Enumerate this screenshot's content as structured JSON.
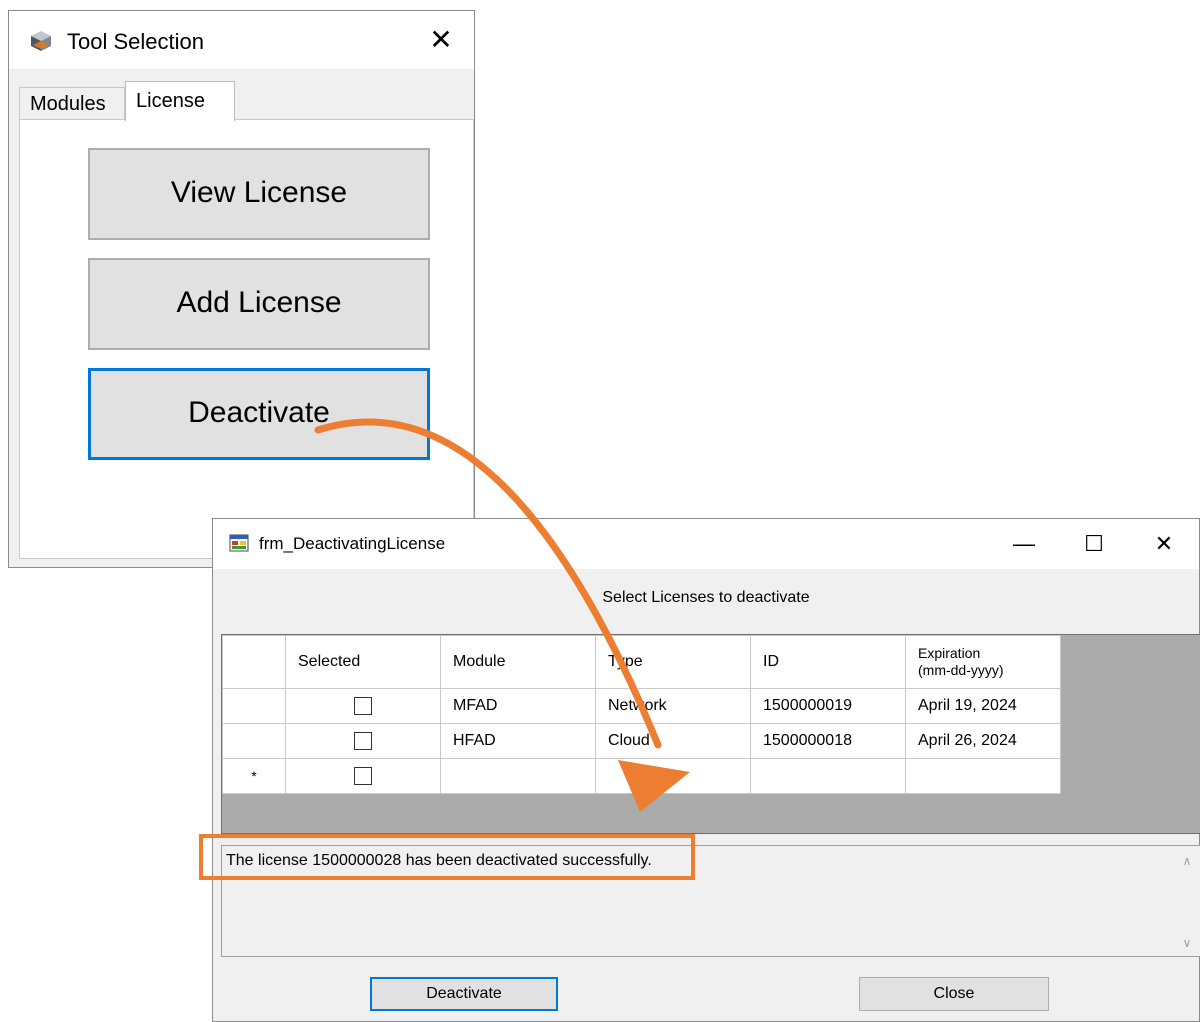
{
  "tool_window": {
    "title": "Tool Selection",
    "close_glyph": "✕",
    "icon": "cube-icon",
    "tabs": [
      {
        "label": "Modules",
        "selected": false
      },
      {
        "label": "License",
        "selected": true
      }
    ],
    "buttons": {
      "view": "View License",
      "add": "Add License",
      "deactivate": "Deactivate"
    }
  },
  "deactivate_window": {
    "title": "frm_DeactivatingLicense",
    "icon": "form-icon",
    "controls": {
      "minimize": "—",
      "maximize": "☐",
      "close": "✕"
    },
    "instruction": "Select Licenses to deactivate",
    "grid": {
      "columns": [
        "Selected",
        "Module",
        "Type",
        "ID",
        "Expiration",
        "(mm-dd-yyyy)"
      ],
      "rows": [
        {
          "selected": false,
          "module": "MFAD",
          "type": "Network",
          "id": "1500000019",
          "expiration": "April 19, 2024"
        },
        {
          "selected": false,
          "module": "HFAD",
          "type": "Cloud",
          "id": "1500000018",
          "expiration": "April 26, 2024"
        }
      ],
      "new_row_marker": "*"
    },
    "message": "The license 1500000028 has been deactivated successfully.",
    "buttons": {
      "deactivate": "Deactivate",
      "close": "Close"
    }
  },
  "colors": {
    "accent": "#0078d7",
    "highlight": "#ed7d31",
    "grid_bg": "#ababab"
  }
}
